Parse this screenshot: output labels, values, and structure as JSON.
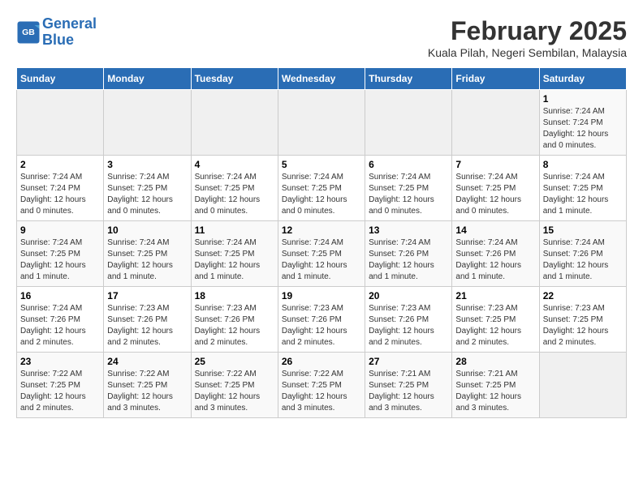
{
  "logo": {
    "line1": "General",
    "line2": "Blue"
  },
  "title": "February 2025",
  "subtitle": "Kuala Pilah, Negeri Sembilan, Malaysia",
  "days_of_week": [
    "Sunday",
    "Monday",
    "Tuesday",
    "Wednesday",
    "Thursday",
    "Friday",
    "Saturday"
  ],
  "weeks": [
    [
      {
        "day": "",
        "info": ""
      },
      {
        "day": "",
        "info": ""
      },
      {
        "day": "",
        "info": ""
      },
      {
        "day": "",
        "info": ""
      },
      {
        "day": "",
        "info": ""
      },
      {
        "day": "",
        "info": ""
      },
      {
        "day": "1",
        "info": "Sunrise: 7:24 AM\nSunset: 7:24 PM\nDaylight: 12 hours and 0 minutes."
      }
    ],
    [
      {
        "day": "2",
        "info": "Sunrise: 7:24 AM\nSunset: 7:24 PM\nDaylight: 12 hours and 0 minutes."
      },
      {
        "day": "3",
        "info": "Sunrise: 7:24 AM\nSunset: 7:25 PM\nDaylight: 12 hours and 0 minutes."
      },
      {
        "day": "4",
        "info": "Sunrise: 7:24 AM\nSunset: 7:25 PM\nDaylight: 12 hours and 0 minutes."
      },
      {
        "day": "5",
        "info": "Sunrise: 7:24 AM\nSunset: 7:25 PM\nDaylight: 12 hours and 0 minutes."
      },
      {
        "day": "6",
        "info": "Sunrise: 7:24 AM\nSunset: 7:25 PM\nDaylight: 12 hours and 0 minutes."
      },
      {
        "day": "7",
        "info": "Sunrise: 7:24 AM\nSunset: 7:25 PM\nDaylight: 12 hours and 0 minutes."
      },
      {
        "day": "8",
        "info": "Sunrise: 7:24 AM\nSunset: 7:25 PM\nDaylight: 12 hours and 1 minute."
      }
    ],
    [
      {
        "day": "9",
        "info": "Sunrise: 7:24 AM\nSunset: 7:25 PM\nDaylight: 12 hours and 1 minute."
      },
      {
        "day": "10",
        "info": "Sunrise: 7:24 AM\nSunset: 7:25 PM\nDaylight: 12 hours and 1 minute."
      },
      {
        "day": "11",
        "info": "Sunrise: 7:24 AM\nSunset: 7:25 PM\nDaylight: 12 hours and 1 minute."
      },
      {
        "day": "12",
        "info": "Sunrise: 7:24 AM\nSunset: 7:25 PM\nDaylight: 12 hours and 1 minute."
      },
      {
        "day": "13",
        "info": "Sunrise: 7:24 AM\nSunset: 7:26 PM\nDaylight: 12 hours and 1 minute."
      },
      {
        "day": "14",
        "info": "Sunrise: 7:24 AM\nSunset: 7:26 PM\nDaylight: 12 hours and 1 minute."
      },
      {
        "day": "15",
        "info": "Sunrise: 7:24 AM\nSunset: 7:26 PM\nDaylight: 12 hours and 1 minute."
      }
    ],
    [
      {
        "day": "16",
        "info": "Sunrise: 7:24 AM\nSunset: 7:26 PM\nDaylight: 12 hours and 2 minutes."
      },
      {
        "day": "17",
        "info": "Sunrise: 7:23 AM\nSunset: 7:26 PM\nDaylight: 12 hours and 2 minutes."
      },
      {
        "day": "18",
        "info": "Sunrise: 7:23 AM\nSunset: 7:26 PM\nDaylight: 12 hours and 2 minutes."
      },
      {
        "day": "19",
        "info": "Sunrise: 7:23 AM\nSunset: 7:26 PM\nDaylight: 12 hours and 2 minutes."
      },
      {
        "day": "20",
        "info": "Sunrise: 7:23 AM\nSunset: 7:26 PM\nDaylight: 12 hours and 2 minutes."
      },
      {
        "day": "21",
        "info": "Sunrise: 7:23 AM\nSunset: 7:25 PM\nDaylight: 12 hours and 2 minutes."
      },
      {
        "day": "22",
        "info": "Sunrise: 7:23 AM\nSunset: 7:25 PM\nDaylight: 12 hours and 2 minutes."
      }
    ],
    [
      {
        "day": "23",
        "info": "Sunrise: 7:22 AM\nSunset: 7:25 PM\nDaylight: 12 hours and 2 minutes."
      },
      {
        "day": "24",
        "info": "Sunrise: 7:22 AM\nSunset: 7:25 PM\nDaylight: 12 hours and 3 minutes."
      },
      {
        "day": "25",
        "info": "Sunrise: 7:22 AM\nSunset: 7:25 PM\nDaylight: 12 hours and 3 minutes."
      },
      {
        "day": "26",
        "info": "Sunrise: 7:22 AM\nSunset: 7:25 PM\nDaylight: 12 hours and 3 minutes."
      },
      {
        "day": "27",
        "info": "Sunrise: 7:21 AM\nSunset: 7:25 PM\nDaylight: 12 hours and 3 minutes."
      },
      {
        "day": "28",
        "info": "Sunrise: 7:21 AM\nSunset: 7:25 PM\nDaylight: 12 hours and 3 minutes."
      },
      {
        "day": "",
        "info": ""
      }
    ]
  ]
}
